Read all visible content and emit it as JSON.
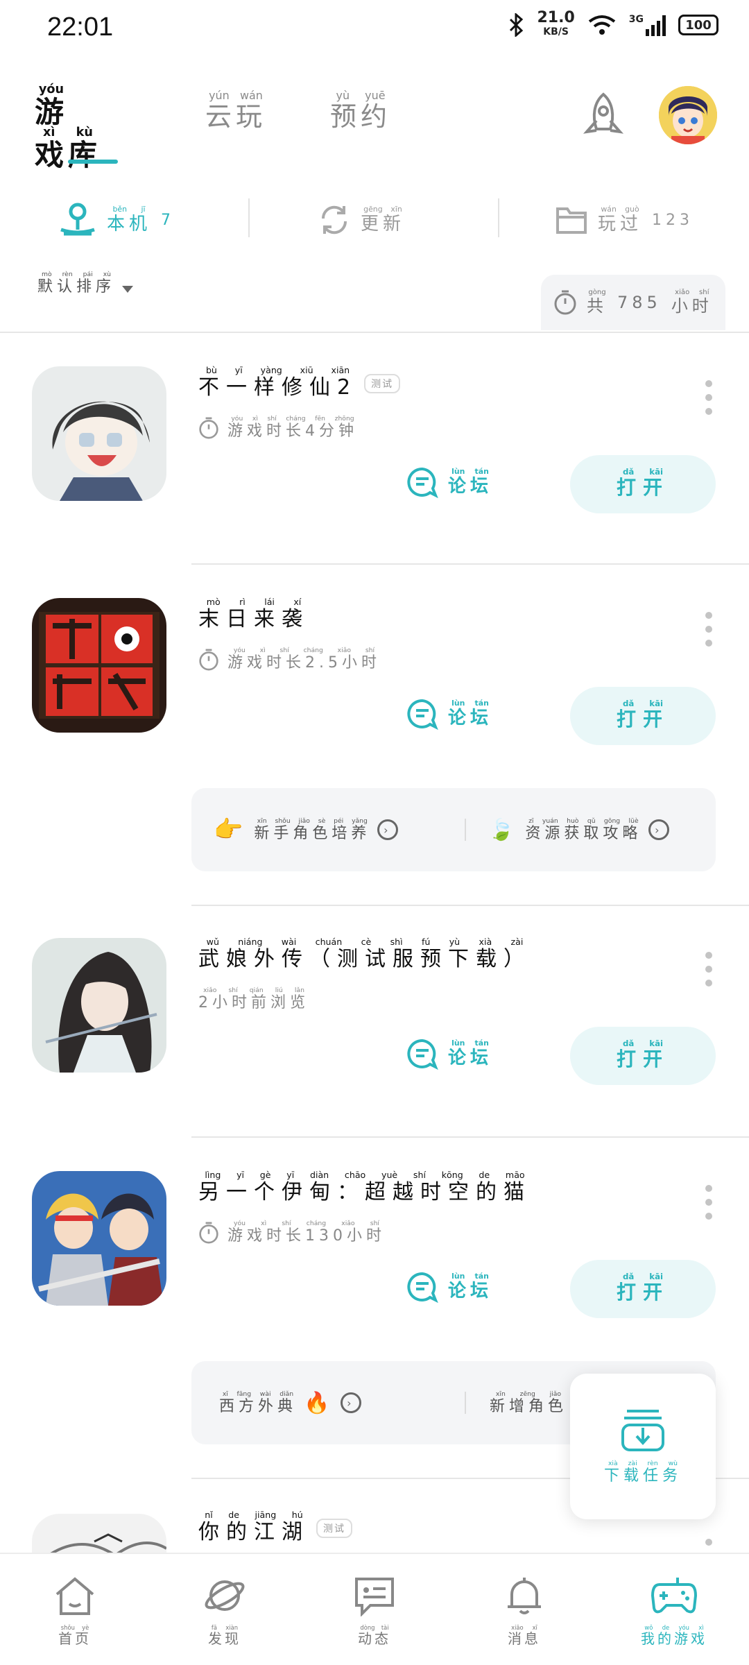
{
  "status_bar": {
    "time": "22:01",
    "speed": "21.0",
    "speed_unit": "KB/S",
    "signal": "3G",
    "battery": "100"
  },
  "top_tabs": [
    {
      "label": "游戏库",
      "pinyin": "yóu xì kù",
      "active": true
    },
    {
      "label": "云玩",
      "pinyin": "yún wán",
      "active": false
    },
    {
      "label": "预约",
      "pinyin": "yù yuē",
      "active": false
    }
  ],
  "sub_tabs": [
    {
      "label": "本机",
      "pinyin": "běn jī",
      "count": "7",
      "icon": "joystick-icon"
    },
    {
      "label": "更新",
      "pinyin": "gēng xīn",
      "count": "",
      "icon": "refresh-icon"
    },
    {
      "label": "玩过",
      "pinyin": "wán guò",
      "count": "123",
      "icon": "folder-icon"
    }
  ],
  "sort": {
    "label": "默认排序",
    "pinyin": "mò rèn pái xù"
  },
  "total": {
    "prefix": "共",
    "prefix_pinyin": "gòng",
    "value": "785",
    "unit": "小时",
    "unit_pinyin": "xiǎo shí"
  },
  "games": [
    {
      "title": "不一样修仙2",
      "title_pinyin": "bù yī yàng xiū xiān",
      "badge": "测试",
      "meta": "游戏时长4分钟",
      "meta_pinyin": "yóu xì shí cháng fēn zhōng"
    },
    {
      "title": "末日来袭",
      "title_pinyin": "mò rì lái xí",
      "badge": "",
      "meta": "游戏时长2.5小时",
      "meta_pinyin": "yóu xì shí cháng xiǎo shí"
    },
    {
      "title": "武娘外传（测试服预下载）",
      "title_pinyin": "wǔ niáng wài chuán cè shì fú yù xià zài",
      "badge": "",
      "meta": "2小时前浏览",
      "meta_pinyin": "xiǎo shí qián liú lǎn"
    },
    {
      "title": "另一个伊甸：超越时空的猫",
      "title_pinyin": "lìng yī gè yī diàn chāo yuè shí kōng de māo",
      "badge": "",
      "meta": "游戏时长130小时",
      "meta_pinyin": "yóu xì shí cháng xiǎo shí"
    },
    {
      "title": "你的江湖",
      "title_pinyin": "nǐ de jiāng hú",
      "badge": "测试",
      "meta": "",
      "meta_pinyin": ""
    }
  ],
  "actions": {
    "forum": "论坛",
    "forum_pinyin": "lùn tán",
    "open": "打开",
    "open_pinyin": "dǎ kāi"
  },
  "tips_1": [
    {
      "label": "新手角色培养",
      "pinyin": "xīn shǒu jiǎo sè péi yǎng"
    },
    {
      "label": "资源获取攻略",
      "pinyin": "zī yuán huò qǔ gōng lüè"
    }
  ],
  "tips_2": [
    {
      "label": "西方外典",
      "pinyin": "xī fāng wài diǎn"
    },
    {
      "label": "新增角色",
      "pinyin": "xīn zēng jiǎo"
    }
  ],
  "download": {
    "label": "下载任务",
    "pinyin": "xià zài rèn wù"
  },
  "bottom_nav": [
    {
      "label": "首页",
      "pinyin": "shǒu yè",
      "active": false
    },
    {
      "label": "发现",
      "pinyin": "fā xiàn",
      "active": false
    },
    {
      "label": "动态",
      "pinyin": "dòng tài",
      "active": false
    },
    {
      "label": "消息",
      "pinyin": "xiāo xī",
      "active": false
    },
    {
      "label": "我的游戏",
      "pinyin": "wǒ de yóu xì",
      "active": true
    }
  ],
  "colors": {
    "accent": "#2bb5bd",
    "accent_light": "#e9f7f8"
  }
}
